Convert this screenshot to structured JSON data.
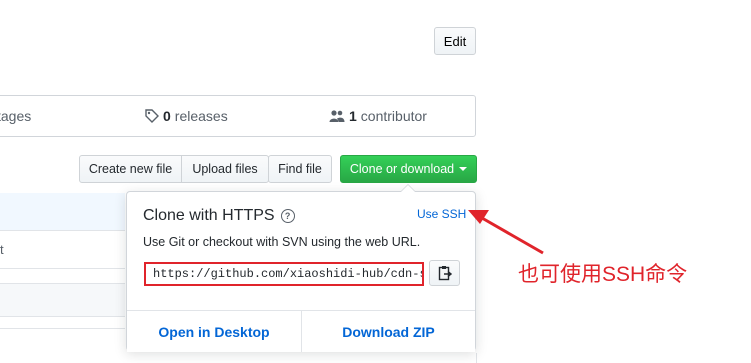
{
  "header": {
    "edit_label": "Edit"
  },
  "stats": {
    "packages_partial": "tages",
    "releases_count": "0",
    "releases_label": "releases",
    "contributors_count": "1",
    "contributors_label": "contributor"
  },
  "toolbar": {
    "create_file": "Create new file",
    "upload_files": "Upload files",
    "find_file": "Find file",
    "clone_download": "Clone or download"
  },
  "file_list": {
    "row_partial_text": "t"
  },
  "clone_popover": {
    "title": "Clone with HTTPS",
    "help_icon_text": "?",
    "use_ssh_label": "Use SSH",
    "description": "Use Git or checkout with SVN using the web URL.",
    "url_value": "https://github.com/xiaoshidi-hub/cdn-spe",
    "open_desktop_label": "Open in Desktop",
    "download_zip_label": "Download ZIP"
  },
  "annotation": {
    "text": "也可使用SSH命令",
    "color": "#e0242b"
  },
  "icons": {
    "tag": "tag-icon",
    "people": "people-icon",
    "help": "question-circle-icon",
    "clipboard": "clipboard-icon",
    "caret": "caret-down-icon"
  },
  "colors": {
    "primary_green": "#28a745",
    "link_blue": "#0366d6",
    "annotation_red": "#e0242b"
  }
}
